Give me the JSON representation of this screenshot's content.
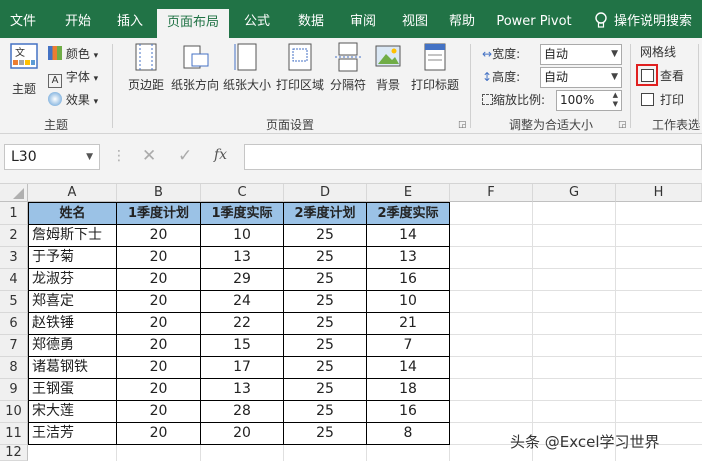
{
  "tabs": [
    "文件",
    "开始",
    "插入",
    "页面布局",
    "公式",
    "数据",
    "审阅",
    "视图",
    "帮助",
    "Power Pivot",
    "操作说明搜索"
  ],
  "active_tab": "页面布局",
  "ribbon": {
    "theme": {
      "main_label": "主题",
      "colors": "颜色",
      "fonts": "字体",
      "effects": "效果",
      "group_label": "主题"
    },
    "page_setup": {
      "margins": "页边距",
      "orientation": "纸张方向",
      "size": "纸张大小",
      "print_area": "打印区域",
      "breaks": "分隔符",
      "background": "背景",
      "print_titles": "打印标题",
      "group_label": "页面设置"
    },
    "scale": {
      "width_label": "宽度:",
      "width_value": "自动",
      "height_label": "高度:",
      "height_value": "自动",
      "scale_label": "缩放比例:",
      "scale_value": "100%",
      "group_label": "调整为合适大小"
    },
    "sheet_options": {
      "gridlines": "网格线",
      "view": "查看",
      "print": "打印",
      "group_label": "工作表选",
      "view_checked": false,
      "print_checked": false,
      "highlight_color": "#e02020"
    }
  },
  "formula_bar": {
    "name_box": "L30",
    "formula": ""
  },
  "columns": [
    "A",
    "B",
    "C",
    "D",
    "E",
    "F",
    "G",
    "H"
  ],
  "rows": [
    "1",
    "2",
    "3",
    "4",
    "5",
    "6",
    "7",
    "8",
    "9",
    "10",
    "11",
    "12"
  ],
  "table": {
    "headers": [
      "姓名",
      "1季度计划",
      "1季度实际",
      "2季度计划",
      "2季度实际"
    ],
    "rows": [
      [
        "詹姆斯下士",
        "20",
        "10",
        "25",
        "14"
      ],
      [
        "于予菊",
        "20",
        "13",
        "25",
        "13"
      ],
      [
        "龙淑芬",
        "20",
        "29",
        "25",
        "16"
      ],
      [
        "郑喜定",
        "20",
        "24",
        "25",
        "10"
      ],
      [
        "赵铁锤",
        "20",
        "22",
        "25",
        "21"
      ],
      [
        "郑德勇",
        "20",
        "15",
        "25",
        "7"
      ],
      [
        "诸葛钢铁",
        "20",
        "17",
        "25",
        "14"
      ],
      [
        "王钢蛋",
        "20",
        "13",
        "25",
        "18"
      ],
      [
        "宋大莲",
        "20",
        "28",
        "25",
        "16"
      ],
      [
        "王洁芳",
        "20",
        "20",
        "25",
        "8"
      ]
    ],
    "header_color": "#9bc2e6"
  },
  "watermark": "头条 @Excel学习世界"
}
